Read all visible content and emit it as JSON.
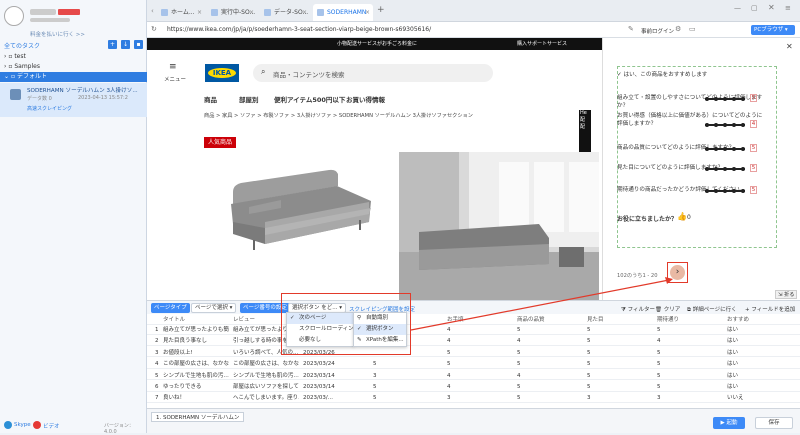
{
  "sidebar": {
    "search_hint": "料金を払いに行く >>",
    "all_tasks": "全てのタスク",
    "tree": [
      {
        "label": "test"
      },
      {
        "label": "Samples"
      },
      {
        "label": "デフォルト"
      }
    ],
    "task": {
      "title": "SODERHAMN ソーデルハムン 3人掛けソ...",
      "meta": "データ数 0",
      "date": "2023-04-13 15:57:2",
      "link": "高速スクレイピング"
    },
    "footer": {
      "skype": "Skype",
      "video": "ビデオ",
      "version": "バージョン：4.0.0"
    }
  },
  "browser": {
    "tabs": [
      {
        "label": "ホーム..."
      },
      {
        "label": "実行中-SO..."
      },
      {
        "label": "データ-SO..."
      },
      {
        "label": "SODERHAMN"
      }
    ],
    "new_tab": "+",
    "url": "https://www.ikea.com/jp/ja/p/soederhamn-3-seat-section-viarp-beige-brown-s69305616/",
    "login": "事前ログイン",
    "pc_browser": "PCブラウザ"
  },
  "ikea": {
    "top_bar": [
      "小物配送サービスがお手ごろ料金に",
      "購入サポートサービス"
    ],
    "menu_label": "メニュー",
    "logo": "IKEA",
    "search_placeholder": "商品・コンテンツを検索",
    "nav": [
      "商品",
      "部屋別",
      "便利アイテム500円以下",
      "お買い得情報"
    ],
    "breadcrumb": "商品 > 家具 > ソファ > 布製ソファ > 3人掛けソファ > SODERHAMN ソーデルハムン 3人掛けソファセクション",
    "badge": "人気商品",
    "side_tab": "He\n配\n配"
  },
  "panel": {
    "recommend": "はい、この商品をおすすめします",
    "ratings": [
      {
        "q": "組み立て・設置のしやすさについてどのように評価しますか？",
        "v": "5"
      },
      {
        "q": "お買い得感（価格以上に価値がある）についてどのように評価しますか？",
        "v": "4"
      },
      {
        "q": "商品の品質についてどのように評価しますか？",
        "v": "5"
      },
      {
        "q": "見た目についてどのように評価しますか？",
        "v": "5"
      },
      {
        "q": "期待通りの商品だったかどうか評価してください。",
        "v": "5"
      }
    ],
    "helpful": "お役に立ちましたか？",
    "helpful_count": "0",
    "pagination": "102のうち1 - 20",
    "next": "›",
    "fold": "折る"
  },
  "toolbar": {
    "page_type": "ページタイプ",
    "page_select": "ページで選択",
    "page_settings": "ページ番号の設定",
    "select_btn": "選択ボタン をど...",
    "scrape_range": "スクレイピング範囲を設定",
    "filter": "フィルター",
    "clear": "クリア",
    "goto_detail": "詳細ページに行く",
    "add_field": "フィールドを追加"
  },
  "dropdown1": {
    "items": [
      {
        "label": "次のページ",
        "checked": true
      },
      {
        "label": "スクロールローディング",
        "checked": false
      },
      {
        "label": "必要なし",
        "checked": false
      }
    ]
  },
  "dropdown2": {
    "items": [
      {
        "label": "自動識別",
        "checked": false
      },
      {
        "label": "選択ボタン",
        "checked": true
      },
      {
        "label": "XPathを編集...",
        "checked": false
      }
    ]
  },
  "grid": {
    "headers": [
      "",
      "タイトル",
      "レビュー",
      "",
      "",
      "お手頃",
      "商品の品質",
      "見た目",
      "期待通り",
      "おすすめ"
    ],
    "rows": [
      [
        "1",
        "組み立てが思ったよりも簡...",
        "組み立てが思ったよりも簡...",
        "2023/03/...",
        "",
        "4",
        "5",
        "5",
        "5",
        "はい"
      ],
      [
        "2",
        "見た目良う事なし",
        "引っ越しする時の事を考え...",
        "2023/03/...",
        "",
        "4",
        "4",
        "5",
        "4",
        "はい"
      ],
      [
        "3",
        "お値段以上!",
        "いろいろ調べて、人気の...",
        "2023/03/26",
        "",
        "5",
        "5",
        "5",
        "5",
        "はい"
      ],
      [
        "4",
        "この部屋の広さは、なかな...",
        "この部屋の広さは、なかな...",
        "2023/03/24",
        "5",
        "5",
        "5",
        "5",
        "5",
        "はい"
      ],
      [
        "5",
        "シンプルで生地も肌の汚…",
        "シンプルで生地も肌の汚…",
        "2023/03/14",
        "3",
        "4",
        "4",
        "5",
        "5",
        "はい"
      ],
      [
        "6",
        "ゆったりできる",
        "部屋は広いソファを探して…",
        "2023/03/14",
        "5",
        "4",
        "5",
        "5",
        "5",
        "はい"
      ],
      [
        "7",
        "良いね！",
        "へこんでしまいます。座り…",
        "2023/03/...",
        "5",
        "3",
        "5",
        "3",
        "3",
        "いいえ"
      ]
    ]
  },
  "bottom": {
    "tab": "1. SODERHAMN ソーデルハムン",
    "start": "起動",
    "save": "保存"
  }
}
